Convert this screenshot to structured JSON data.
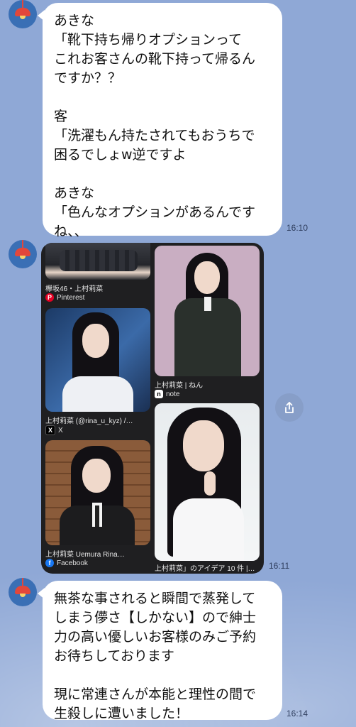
{
  "messages": [
    {
      "text": "あきな\n「靴下持ち帰りオプションって\nこれお客さんの靴下持って帰るん\nですか？？\n\n客\n「洗濯もん持たされてもおうちで\n困るでしょw逆ですよ\n\nあきな\n「色んなオプションがあるんです\nね、、",
      "time": "16:10"
    },
    {
      "time": "16:11"
    },
    {
      "text": "無茶な事されると瞬間で蒸発して\nしまう儚さ【しかない】ので紳士\n力の高い優しいお客様のみご予約\nお待ちしております\n\n現に常連さんが本能と理性の間で\n生殺しに遭いました！",
      "time": "16:14"
    }
  ],
  "gallery": {
    "items": [
      {
        "title": "欅坂46・上村莉菜",
        "source": "Pinterest",
        "source_icon": "pinterest-icon",
        "icon_color": "#e60023"
      },
      {
        "title": "上村莉菜 | ねん",
        "source": "note",
        "source_icon": "note-icon",
        "icon_color": "#ffffff"
      },
      {
        "title": "上村莉菜 (@rina_u_kyz) /…",
        "source": "X",
        "source_icon": "x-icon",
        "icon_color": "#000000"
      },
      {
        "title": "上村莉菜 Uemura Rina…",
        "source": "Facebook",
        "source_icon": "facebook-icon",
        "icon_color": "#1877f2"
      },
      {
        "title": "上村莉菜」のアイデア 10 件 |…",
        "source": "",
        "source_icon": "",
        "icon_color": ""
      }
    ]
  },
  "share_button": {
    "icon": "share-icon"
  },
  "colors": {
    "background": "#8fa8d6",
    "bubble": "#ffffff",
    "avatar": "#3a6fb5",
    "lamp": "#e2473b"
  }
}
